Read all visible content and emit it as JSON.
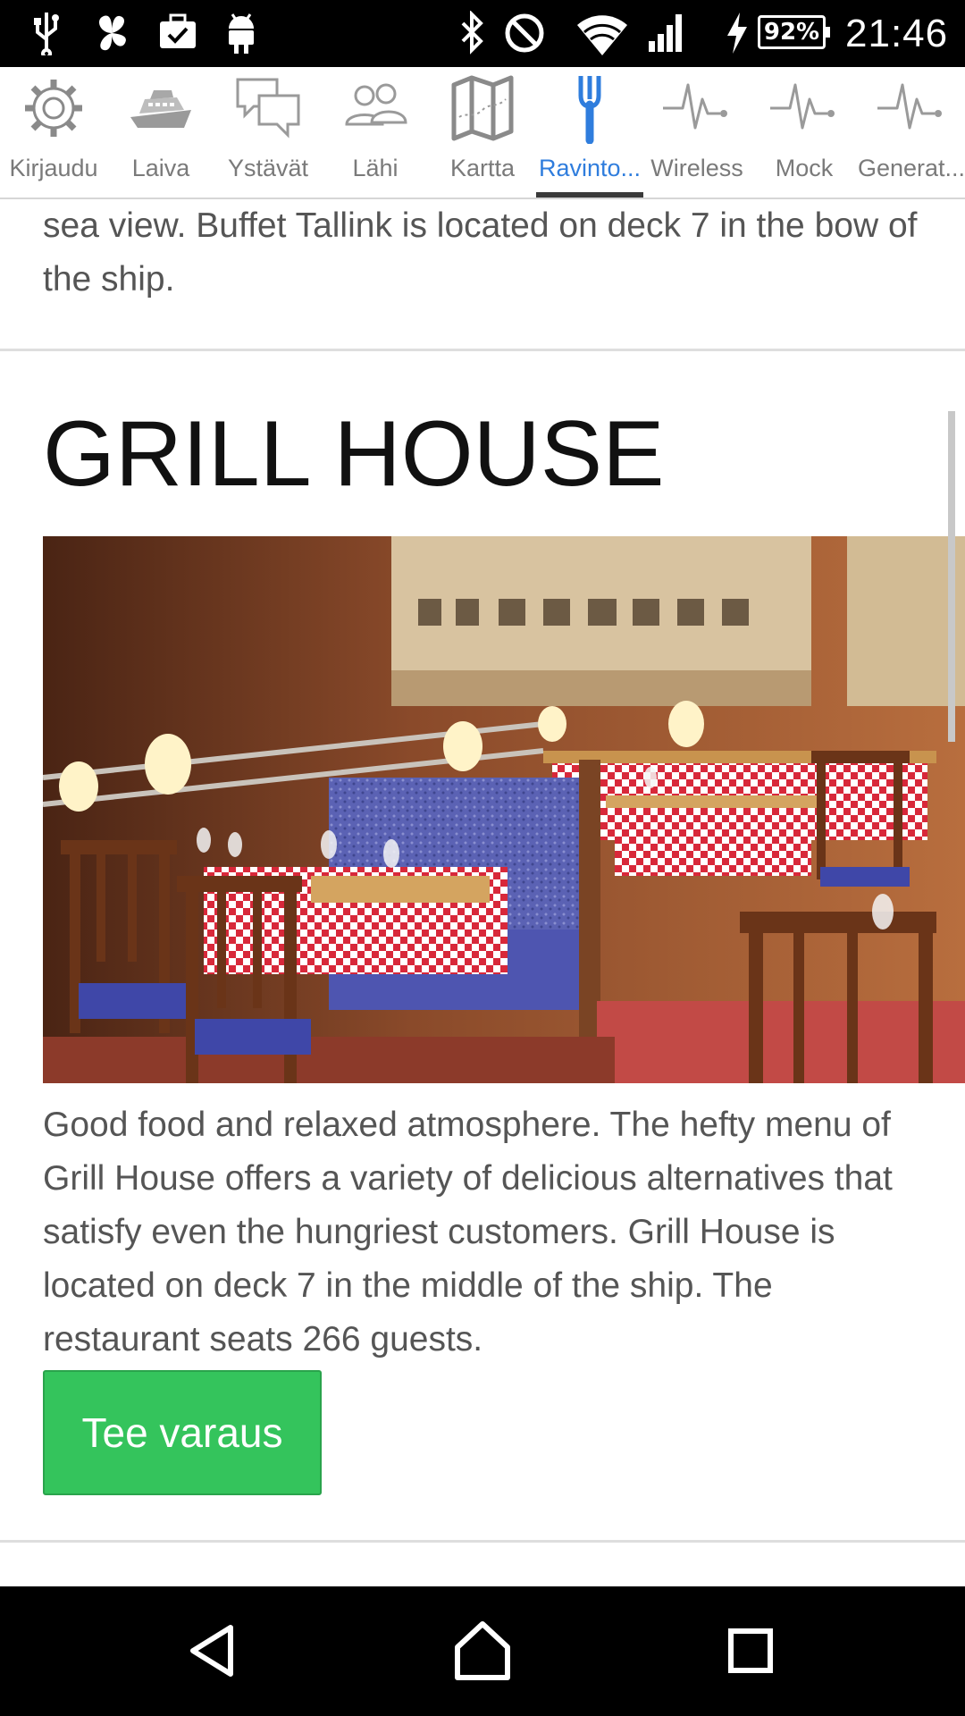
{
  "status_bar": {
    "battery": "92%",
    "clock": "21:46"
  },
  "tabs": [
    {
      "label": "Kirjaudu",
      "icon": "gear-icon",
      "active": false
    },
    {
      "label": "Laiva",
      "icon": "ship-icon",
      "active": false
    },
    {
      "label": "Ystävät",
      "icon": "chat-bubbles-icon",
      "active": false
    },
    {
      "label": "Lähi",
      "icon": "people-icon",
      "active": false
    },
    {
      "label": "Kartta",
      "icon": "map-icon",
      "active": false
    },
    {
      "label": "Ravinto...",
      "icon": "fork-icon",
      "active": true
    },
    {
      "label": "Wireless",
      "icon": "pulse-icon",
      "active": false
    },
    {
      "label": "Mock",
      "icon": "pulse-icon",
      "active": false
    },
    {
      "label": "Generat...",
      "icon": "pulse-icon",
      "active": false
    }
  ],
  "content": {
    "previous_text": "sea view. Buffet Tallink is located on deck 7 in the bow of the ship.",
    "section_title": "GRILL HOUSE",
    "description": "Good food and relaxed atmosphere. The hefty menu of Grill House offers a variety of delicious alternatives that satisfy even the hungriest customers. Grill House is located on deck 7 in the middle of the ship. The restaurant seats 266 guests.",
    "reserve_button": "Tee varaus"
  },
  "colors": {
    "accent": "#2f7ddd",
    "button": "#34c45c",
    "tab_inactive": "#7a7a7a"
  },
  "navbar": [
    "back-icon",
    "home-icon",
    "recents-icon"
  ]
}
